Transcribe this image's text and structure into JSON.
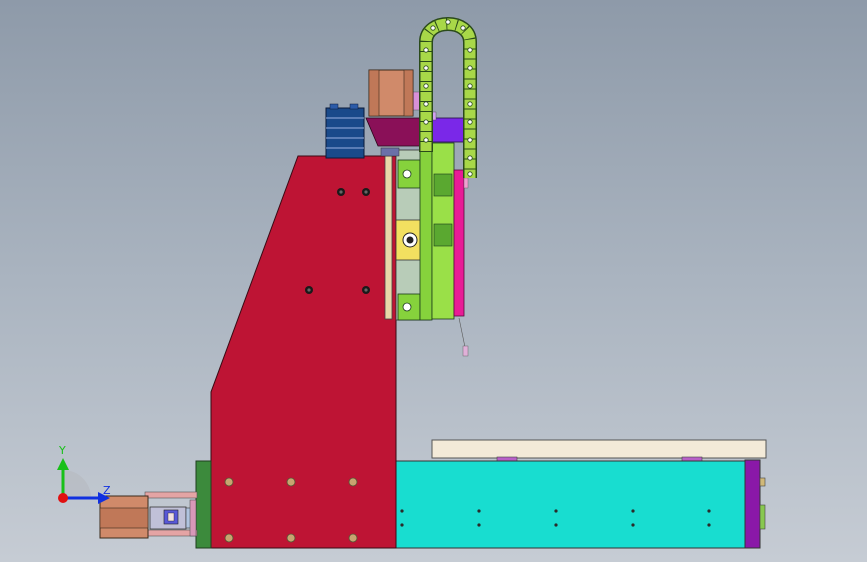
{
  "axes": {
    "y_label": "Y",
    "z_label": "Z",
    "x_color": "#e01010",
    "y_color": "#18c018",
    "z_color": "#1030e0"
  },
  "colors": {
    "column": "#be1434",
    "base_bed": "#18ddd0",
    "work_table": "#f3ead8",
    "z_axis_plate": "#86d23c",
    "cable_chain": "#a8d848",
    "motor": "#d08a6a",
    "end_plate": "#8a18a8",
    "pink_rail": "#e81c96",
    "bracket": "#8a1058",
    "clamp": "#f2e060",
    "foot": "#3c8a3c"
  }
}
